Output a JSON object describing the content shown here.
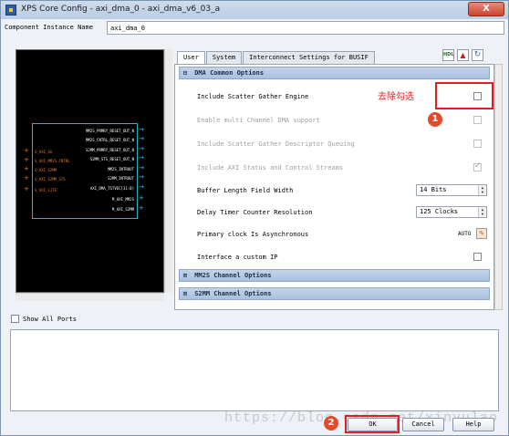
{
  "window": {
    "title": "XPS Core Config - axi_dma_0 - axi_dma_v6_03_a",
    "close_label": "X"
  },
  "component_instance": {
    "label": "Component Instance Name",
    "value": "axi_dma_0"
  },
  "schematic": {
    "left_ports": [
      "S_AXI_SG",
      "S_AXI_MM2S_CNTRL",
      "S_AXI_S2MM",
      "S_AXI_S2MM_STS",
      "S_AXI_LITE"
    ],
    "right_ports": [
      "MM2S_PRMRY_RESET_OUT_N",
      "MM2S_CNTRL_RESET_OUT_N",
      "S2MM_PRMRY_RESET_OUT_N",
      "S2MM_STS_RESET_OUT_N",
      "MM2S_INTROUT",
      "S2MM_INTROUT",
      "AXI_DMA_TSTVEC[31:0]",
      "M_AXI_MM2S",
      "M_AXI_S2MM"
    ]
  },
  "show_all_ports": "Show All Ports",
  "tabs": [
    "User",
    "System",
    "Interconnect Settings for BUSIF"
  ],
  "header_icons": [
    "HDL",
    "pdf-icon",
    "refresh-icon"
  ],
  "sections": {
    "dma_common": "DMA Common Options",
    "mm2s": "MM2S Channel Options",
    "s2mm": "S2MM Channel Options"
  },
  "options": [
    {
      "label": "Include Scatter Gather Engine",
      "checked": false,
      "disabled": false
    },
    {
      "label": "Enable multi Channel DMA support",
      "checked": false,
      "disabled": true
    },
    {
      "label": "Include Scatter Gather Descriptor Queuing",
      "checked": false,
      "disabled": true
    },
    {
      "label": "Include AXI Status and Control Streams",
      "checked": true,
      "disabled": true
    },
    {
      "label": "Buffer Length Field Width",
      "value": "14 Bits"
    },
    {
      "label": "Delay Timer Counter Resolution",
      "value": "125 Clocks"
    },
    {
      "label": "Primary clock Is Asynchronous",
      "value": "AUTO"
    },
    {
      "label": "Interface a custom IP",
      "checked": false,
      "disabled": false
    }
  ],
  "buttons": {
    "ok": "OK",
    "cancel": "Cancel",
    "help": "Help"
  },
  "annotations": {
    "note": "去除勾选",
    "n1": "1",
    "n2": "2"
  },
  "watermark": "https://blog.csdn.net/xinyulao",
  "colors": {
    "annotation": "#e02020",
    "accent": "#a9c0e0",
    "port_in": "#e07a2c",
    "port_out": "#20c8e0"
  }
}
